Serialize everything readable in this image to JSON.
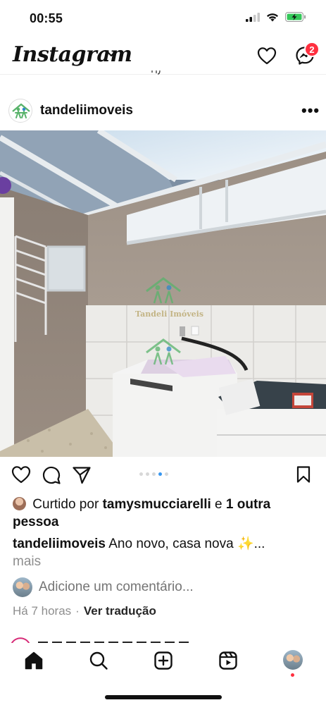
{
  "status_bar": {
    "time": "00:55"
  },
  "header": {
    "logo": "Instagram",
    "notification_count": "2"
  },
  "post": {
    "username": "tandeliimoveis",
    "more_icon": "•••",
    "watermark": "Tandeli Imóveis",
    "carousel": {
      "count": 5,
      "active_index": 3
    },
    "likes": {
      "prefix": "Curtido por",
      "user": "tamysmucciarelli",
      "conjunction": "e",
      "others": "1 outra pessoa"
    },
    "caption": {
      "username": "tandeliimoveis",
      "text": "Ano novo, casa nova ✨...",
      "more": "mais"
    },
    "comment_placeholder": "Adicione um comentário...",
    "time": "Há 7 horas",
    "separator": "·",
    "translate": "Ver tradução"
  },
  "icons": {
    "header": [
      "chevron-down-icon",
      "heart-icon",
      "messenger-icon"
    ],
    "actions": [
      "heart-icon",
      "comment-icon",
      "share-icon",
      "save-icon"
    ],
    "nav": [
      "home-icon",
      "search-icon",
      "new-post-icon",
      "reels-icon",
      "profile-avatar"
    ]
  },
  "colors": {
    "badge": "#ff3040",
    "carousel_active": "#3897f0",
    "secondary_text": "#8e8e8e"
  }
}
